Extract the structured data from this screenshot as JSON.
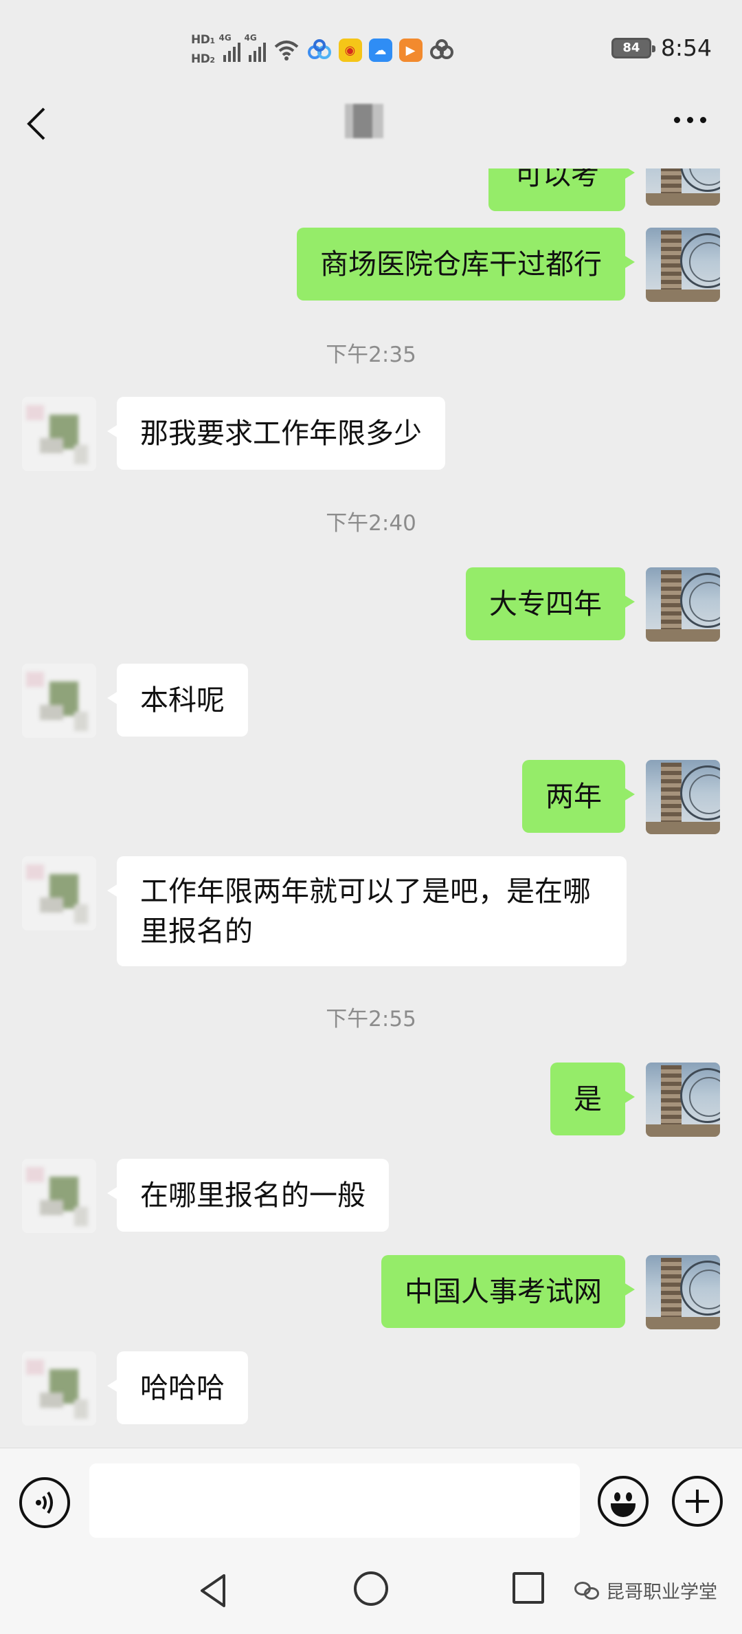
{
  "status_bar": {
    "sim1": "HD",
    "sim1_index": "1",
    "sim2": "HD",
    "sim2_index": "2",
    "network1": "4G",
    "network2": "4G",
    "battery": "84",
    "time": "8:54",
    "notification_icons": [
      "baidu-netdisk-icon",
      "weibo-icon",
      "cloud-icon",
      "video-icon",
      "baidu-netdisk-icon"
    ]
  },
  "header": {
    "back_icon": "chevron-left-icon",
    "more_icon": "more-dots-icon"
  },
  "messages": [
    {
      "side": "out",
      "text": "可以考"
    },
    {
      "side": "out",
      "text": "商场医院仓库干过都行"
    },
    {
      "type": "time",
      "text": "下午2:35"
    },
    {
      "side": "in",
      "text": "那我要求工作年限多少"
    },
    {
      "type": "time",
      "text": "下午2:40"
    },
    {
      "side": "out",
      "text": "大专四年"
    },
    {
      "side": "in",
      "text": "本科呢"
    },
    {
      "side": "out",
      "text": "两年"
    },
    {
      "side": "in",
      "text": "工作年限两年就可以了是吧，是在哪里报名的"
    },
    {
      "type": "time",
      "text": "下午2:55"
    },
    {
      "side": "out",
      "text": "是"
    },
    {
      "side": "in",
      "text": "在哪里报名的一般"
    },
    {
      "side": "out",
      "text": "中国人事考试网"
    },
    {
      "side": "in",
      "text": "哈哈哈"
    }
  ],
  "input_bar": {
    "voice_icon": "voice-icon",
    "input_value": "",
    "emoji_icon": "emoji-icon",
    "plus_icon": "plus-icon"
  },
  "nav_bar": {
    "back_icon": "triangle-back-icon",
    "home_icon": "circle-home-icon",
    "recent_icon": "square-recent-icon"
  },
  "watermark": {
    "text": "昆哥职业学堂"
  },
  "colors": {
    "outgoing_bubble": "#95ec69",
    "incoming_bubble": "#ffffff",
    "background": "#ededed"
  }
}
